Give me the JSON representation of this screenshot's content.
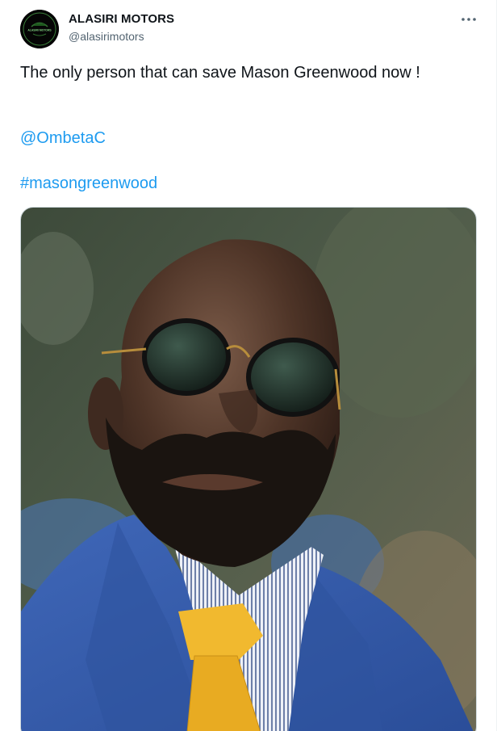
{
  "tweet": {
    "author": {
      "display_name": "ALASIRI MOTORS",
      "handle": "@alasirimotors",
      "avatar_icon": "alasiri-motors-logo",
      "avatar_text": "ALASIRI MOTORS"
    },
    "more_icon": "more-options-icon",
    "text_line": "The only person that can save Mason Greenwood now !",
    "mention": "@OmbetaC",
    "hashtag": "#masongreenwood",
    "media": {
      "type": "photo",
      "subject": "bald man with beard wearing round sunglasses, blue suit, striped shirt and yellow knit tie"
    },
    "colors": {
      "link": "#1d9bf0",
      "secondary_text": "#536471",
      "primary_text": "#0f1419"
    }
  }
}
